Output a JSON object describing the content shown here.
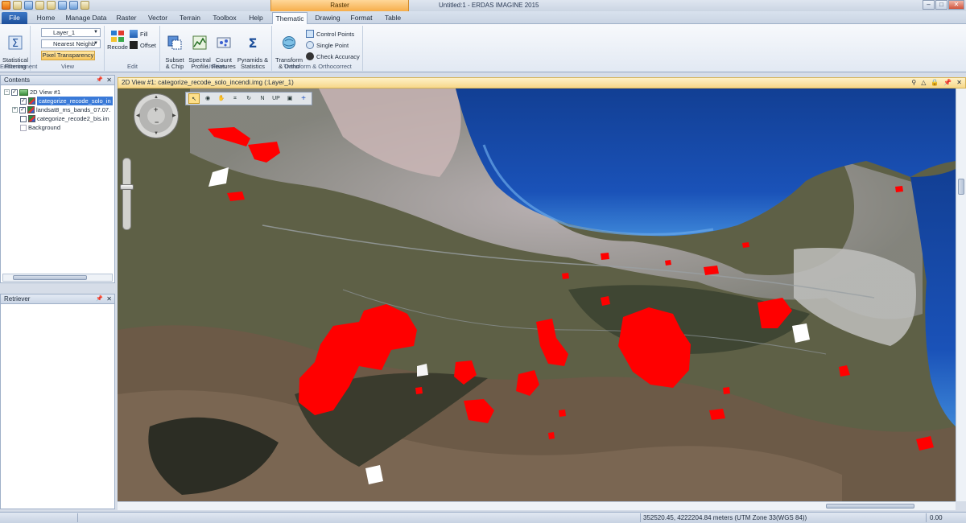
{
  "window": {
    "title": "Untitled:1 - ERDAS IMAGINE 2015",
    "context_tab_group": "Raster",
    "controls": [
      "–",
      "□",
      "✕"
    ]
  },
  "tabs": [
    "File",
    "Home",
    "Manage Data",
    "Raster",
    "Vector",
    "Terrain",
    "Toolbox",
    "Help",
    "Thematic",
    "Drawing",
    "Format",
    "Table"
  ],
  "active_tab": "Thematic",
  "ribbon": {
    "enhancement": {
      "label": "Enhancement",
      "statistical_filtering": "Statistical\nFiltering"
    },
    "view": {
      "label": "View",
      "layer_combo": "Layer_1",
      "resample_combo": "Nearest Neighb",
      "pixel_transparency": "Pixel Transparency"
    },
    "edit": {
      "label": "Edit",
      "recode": "Recode",
      "fill": "Fill",
      "offset": "Offset"
    },
    "utilities": {
      "label": "Utilities",
      "subset_chip": "Subset\n& Chip",
      "spectral_profile": "Spectral\nProfile",
      "count_features": "Count\nFeatures",
      "pyramids_statistics": "Pyramids &\nStatistics"
    },
    "transform": {
      "label": "Transform & Orthocorrect",
      "transform_ortho": "Transform\n& Ortho",
      "control_points": "Control Points",
      "single_point": "Single Point",
      "check_accuracy": "Check Accuracy"
    }
  },
  "contents": {
    "title": "Contents",
    "items": [
      {
        "label": "2D View #1",
        "checked": true
      },
      {
        "label": "categorize_recode_solo_in",
        "checked": true,
        "selected": true
      },
      {
        "label": "landsat8_ms_bands_07.07.",
        "checked": true
      },
      {
        "label": "categorize_recode2_bis.im",
        "checked": false
      },
      {
        "label": "Background"
      }
    ]
  },
  "retriever": {
    "title": "Retriever"
  },
  "view": {
    "title": "2D View #1: categorize_recode_solo_incendi.img (:Layer_1)",
    "toolbar_labels": [
      "",
      "",
      "",
      "",
      "",
      "N",
      "UP",
      "",
      ""
    ]
  },
  "status": {
    "coordinates": "352520.45, 4222204.84 meters (UTM Zone 33(WGS 84))",
    "value": "0.00"
  },
  "colors": {
    "burn": "#ff0000",
    "sea": "#1a52b8",
    "accent": "#f6ad4a"
  }
}
